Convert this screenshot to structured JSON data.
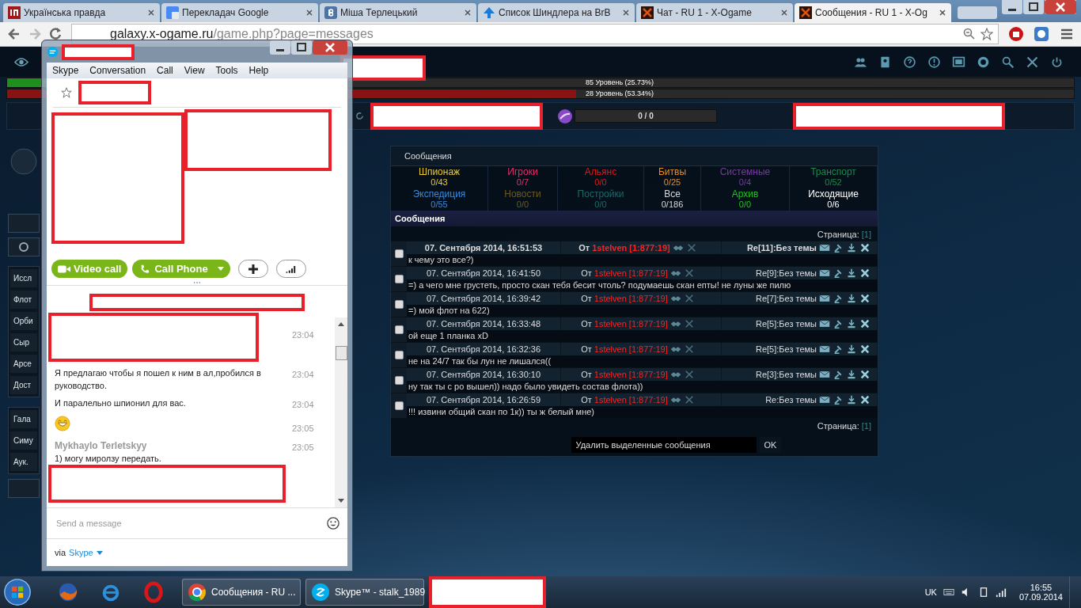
{
  "browser": {
    "tabs": [
      {
        "title": "Українська правда",
        "kind": "up",
        "selected": false
      },
      {
        "title": "Перекладач Google",
        "kind": "translate",
        "selected": false
      },
      {
        "title": "Міша Терлецький",
        "kind": "vk",
        "selected": false
      },
      {
        "title": "Список Шиндлера на BrB",
        "kind": "arrow",
        "selected": false
      },
      {
        "title": "Чат - RU 1 - X-Ogame",
        "kind": "ogame",
        "selected": false
      },
      {
        "title": "Сообщения - RU 1 - X-Og",
        "kind": "ogame",
        "selected": true
      }
    ],
    "address": {
      "host": "galaxy.x-ogame.ru",
      "path": "/game.php?page=messages"
    }
  },
  "game": {
    "level_bars": [
      {
        "label": "85 Уровень (25.73%)",
        "level": 0.2573,
        "color": "#1e8e1e"
      },
      {
        "label": "28 Уровень (53.34%)",
        "level": 0.5334,
        "color": "#8a1212"
      }
    ],
    "resource_meter": {
      "reading": "0 / 0"
    },
    "sidebar": {
      "groups": [
        [
          "Иссл",
          "Флот",
          "Орби",
          "Сыр",
          "Арсе",
          "Дост"
        ],
        [
          "Гала",
          "Симу",
          "Аук."
        ]
      ]
    },
    "messages_panel": {
      "title": "Сообщения",
      "categories": [
        {
          "name": "Шпионаж",
          "count": "0/43",
          "color": "#e8c832"
        },
        {
          "name": "Игроки",
          "count": "0/7",
          "color": "#e0306a"
        },
        {
          "name": "Альянс",
          "count": "0/0",
          "color": "#e01818"
        },
        {
          "name": "Битвы",
          "count": "0/25",
          "color": "#f08c1c"
        },
        {
          "name": "Системные",
          "count": "0/4",
          "color": "#7a3aa0"
        },
        {
          "name": "Транспорт",
          "count": "0/52",
          "color": "#1a8a4a"
        },
        {
          "name": "Экспедиция",
          "count": "0/55",
          "color": "#3a8ad8"
        },
        {
          "name": "Новости",
          "count": "0/0",
          "color": "#6a5a2a"
        },
        {
          "name": "Постройки",
          "count": "0/0",
          "color": "#1a6a6a"
        },
        {
          "name": "Все",
          "count": "0/186",
          "color": "#d8d8d8"
        },
        {
          "name": "Архив",
          "count": "0/0",
          "color": "#22c022"
        },
        {
          "name": "Исходящие",
          "count": "0/6",
          "color": "#ffffff"
        }
      ],
      "section_title": "Сообщения",
      "page_label": "Страница:",
      "page_number": "[1]",
      "bottom_page_label": "Страница:",
      "bottom_page_number": "[1]",
      "messages": [
        {
          "date": "07. Сентября 2014, 16:51:53",
          "from": "От",
          "sender": "1stelven [1:877:19]",
          "subject": "Re[11]:Без темы",
          "text": "к чему это все?)",
          "unread": true,
          "checked": false
        },
        {
          "date": "07. Сентября 2014, 16:41:50",
          "from": "От",
          "sender": "1stelven [1:877:19]",
          "subject": "Re[9]:Без темы",
          "text": "=) а чего мне грустеть, просто скан тебя бесит чтоль? подумаешь скан епты! не луны же пилю",
          "unread": false,
          "checked": false
        },
        {
          "date": "07. Сентября 2014, 16:39:42",
          "from": "От",
          "sender": "1stelven [1:877:19]",
          "subject": "Re[7]:Без темы",
          "text": "=) мой флот на 622)",
          "unread": false,
          "checked": false
        },
        {
          "date": "07. Сентября 2014, 16:33:48",
          "from": "От",
          "sender": "1stelven [1:877:19]",
          "subject": "Re[5]:Без темы",
          "text": "ой еще 1 планка xD",
          "unread": false,
          "checked": false
        },
        {
          "date": "07. Сентября 2014, 16:32:36",
          "from": "От",
          "sender": "1stelven [1:877:19]",
          "subject": "Re[5]:Без темы",
          "text": "не на 24/7 так бы лун не лишался((",
          "unread": false,
          "checked": false
        },
        {
          "date": "07. Сентября 2014, 16:30:10",
          "from": "От",
          "sender": "1stelven [1:877:19]",
          "subject": "Re[3]:Без темы",
          "text": "ну так ты с ро вышел)) надо было увидеть состав флота))",
          "unread": false,
          "checked": false
        },
        {
          "date": "07. Сентября 2014, 16:26:59",
          "from": "От",
          "sender": "1stelven [1:877:19]",
          "subject": "Re:Без темы",
          "text": "!!! извини общий скан по 1к)) ты ж белый мне)",
          "unread": false,
          "checked": false
        }
      ],
      "delete_action": "Удалить выделенные сообщения",
      "ok": "OK"
    }
  },
  "skype": {
    "menu": [
      "Skype",
      "Conversation",
      "Call",
      "View",
      "Tools",
      "Help"
    ],
    "video_call": "Video call",
    "call_phone": "Call Phone",
    "chat": [
      {
        "kind": "redacted",
        "time": "23:04"
      },
      {
        "kind": "text",
        "text": "Я предлагаю чтобы я пошел к ним в ал,пробился в руководство.",
        "time": "23:04"
      },
      {
        "kind": "text",
        "text": "И паралельно шпионил для вас.",
        "time": "23:04"
      },
      {
        "kind": "emoticon",
        "time": "23:05"
      },
      {
        "kind": "text",
        "author": "Mykhaylo Terletskyy",
        "text": "1) могу миролзу передать.",
        "time": "23:05"
      }
    ],
    "placeholder": "Send a message",
    "via": "via",
    "via_link": "Skype"
  },
  "taskbar": {
    "windows": [
      {
        "title": "Сообщения - RU ...",
        "kind": "chrome"
      },
      {
        "title": "Skype™ - stalk_1989",
        "kind": "skype"
      }
    ],
    "language": "UK",
    "time": "16:55",
    "date": "07.09.2014"
  }
}
